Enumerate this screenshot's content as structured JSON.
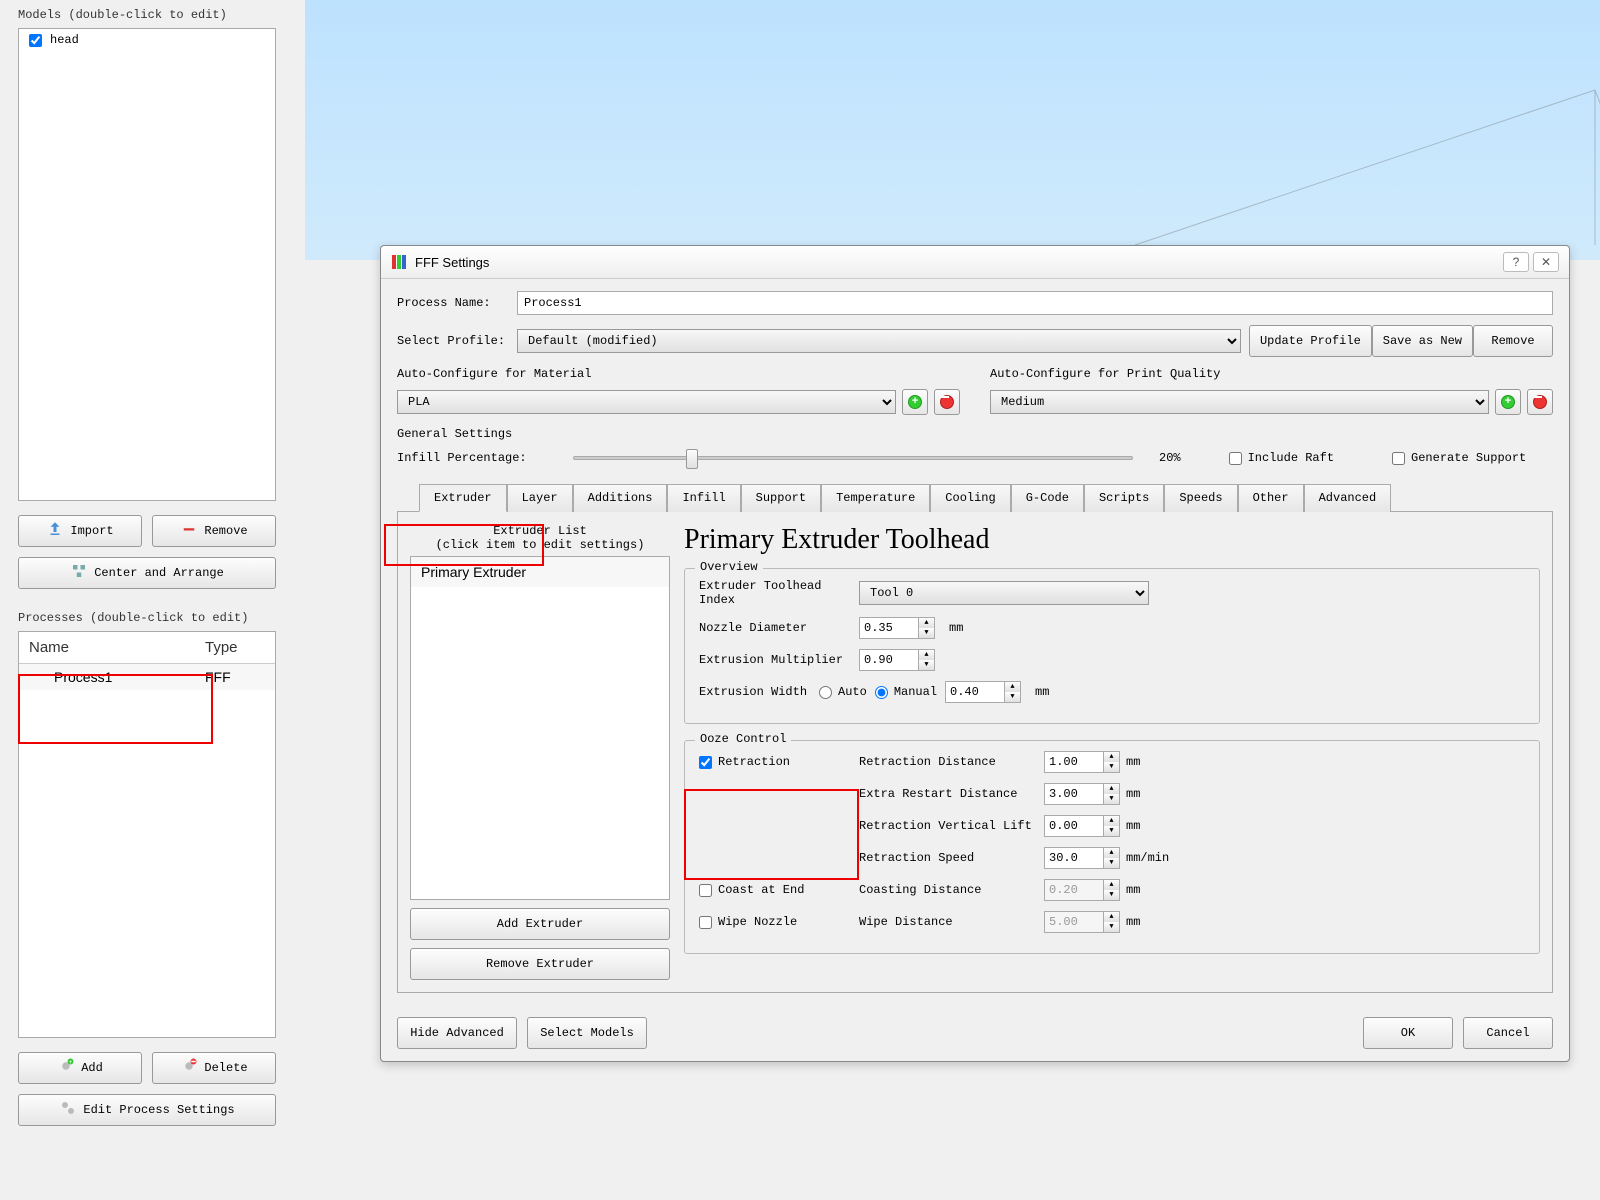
{
  "sidebar": {
    "models_header": "Models (double-click to edit)",
    "model_items": [
      "head"
    ],
    "import_btn": "Import",
    "remove_btn": "Remove",
    "center_btn": "Center and Arrange",
    "processes_header": "Processes (double-click to edit)",
    "procs_cols": {
      "name": "Name",
      "type": "Type"
    },
    "procs_rows": [
      {
        "name": "Process1",
        "type": "FFF"
      }
    ],
    "add_btn": "Add",
    "delete_btn": "Delete",
    "edit_btn": "Edit Process Settings"
  },
  "dialog": {
    "title": "FFF Settings",
    "proc_name_lbl": "Process Name:",
    "proc_name_val": "Process1",
    "select_profile_lbl": "Select Profile:",
    "select_profile_val": "Default (modified)",
    "update_btn": "Update Profile",
    "saveas_btn": "Save as New",
    "remove_btn": "Remove",
    "auto_mat_lbl": "Auto-Configure for Material",
    "auto_mat_val": "PLA",
    "auto_qual_lbl": "Auto-Configure for Print Quality",
    "auto_qual_val": "Medium",
    "gen_settings_lbl": "General Settings",
    "infill_lbl": "Infill Percentage:",
    "infill_pct": "20%",
    "include_raft": "Include Raft",
    "gen_support": "Generate Support",
    "tabs": [
      "Extruder",
      "Layer",
      "Additions",
      "Infill",
      "Support",
      "Temperature",
      "Cooling",
      "G-Code",
      "Scripts",
      "Speeds",
      "Other",
      "Advanced"
    ],
    "extruder_list_lbl1": "Extruder List",
    "extruder_list_lbl2": "(click item to edit settings)",
    "extruder_item": "Primary Extruder",
    "add_extruder": "Add Extruder",
    "remove_extruder": "Remove Extruder",
    "toolhead_title": "Primary Extruder Toolhead",
    "overview_legend": "Overview",
    "toolhead_idx_lbl": "Extruder Toolhead Index",
    "toolhead_idx_val": "Tool 0",
    "nozzle_lbl": "Nozzle Diameter",
    "nozzle_val": "0.35",
    "extmult_lbl": "Extrusion Multiplier",
    "extmult_val": "0.90",
    "extwidth_lbl": "Extrusion Width",
    "auto_lbl": "Auto",
    "manual_lbl": "Manual",
    "extwidth_val": "0.40",
    "mm": "mm",
    "mmmin": "mm/min",
    "ooze_legend": "Ooze Control",
    "retraction_chk": "Retraction",
    "coast_chk": "Coast at End",
    "wipe_chk": "Wipe Nozzle",
    "ret_dist_lbl": "Retraction Distance",
    "ret_dist_val": "1.00",
    "extra_restart_lbl": "Extra Restart Distance",
    "extra_restart_val": "3.00",
    "vlift_lbl": "Retraction Vertical Lift",
    "vlift_val": "0.00",
    "ret_speed_lbl": "Retraction Speed",
    "ret_speed_val": "30.0",
    "coast_dist_lbl": "Coasting Distance",
    "coast_dist_val": "0.20",
    "wipe_dist_lbl": "Wipe Distance",
    "wipe_dist_val": "5.00",
    "hide_adv_btn": "Hide Advanced",
    "select_models_btn": "Select Models",
    "ok_btn": "OK",
    "cancel_btn": "Cancel"
  }
}
